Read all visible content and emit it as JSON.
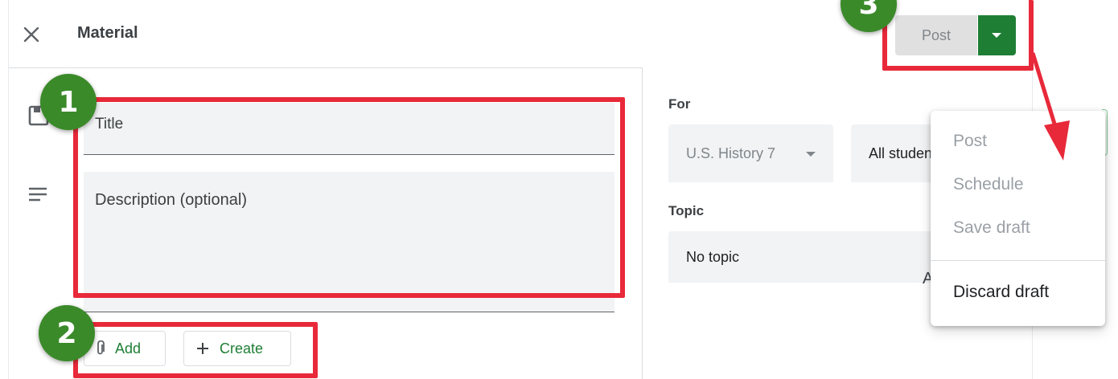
{
  "header": {
    "title": "Material",
    "post_label": "Post"
  },
  "form": {
    "title_placeholder": "Title",
    "description_placeholder": "Description (optional)",
    "add_label": "Add",
    "create_label": "Create"
  },
  "sidebar": {
    "for_label": "For",
    "class_value": "U.S. History 7",
    "students_value": "All students",
    "topic_label": "Topic",
    "topic_value": "No topic",
    "partial_text": "A"
  },
  "dropdown_menu": {
    "items": [
      {
        "label": "Post",
        "enabled": false
      },
      {
        "label": "Schedule",
        "enabled": false
      },
      {
        "label": "Save draft",
        "enabled": false
      },
      {
        "label": "Discard draft",
        "enabled": true
      }
    ]
  },
  "annotations": {
    "badges": [
      "1",
      "2",
      "3"
    ],
    "highlight_color": "#e8293a",
    "badge_color": "#3b8a2a"
  },
  "colors": {
    "accent_green": "#1e7e34",
    "field_bg": "#f1f3f4",
    "disabled_text": "#9aa0a6"
  }
}
